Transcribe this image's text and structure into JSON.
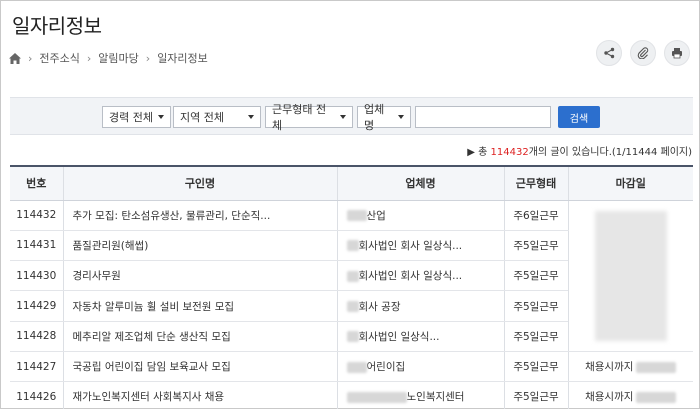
{
  "page": {
    "title": "일자리정보"
  },
  "breadcrumb": {
    "items": [
      "전주소식",
      "알림마당",
      "일자리정보"
    ]
  },
  "filters": {
    "career": "경력 전체",
    "region": "지역 전체",
    "work_type": "근무형태 전체",
    "company": "업체명",
    "search_label": "검색"
  },
  "summary": {
    "prefix": "▶ 총",
    "count": "114432",
    "suffix": "개의 글이 있습니다.(1/11444 페이지)"
  },
  "table": {
    "headers": [
      "번호",
      "구인명",
      "업체명",
      "근무형태",
      "마감일"
    ],
    "rows": [
      {
        "no": "114432",
        "title": "추가 모집: 탄소섬유생산, 물류관리, 단순직...",
        "company": "산업",
        "type": "주6일근무",
        "deadline": ""
      },
      {
        "no": "114431",
        "title": "품질관리원(해썹)",
        "company": "회사법인 회사 일상식...",
        "type": "주5일근무",
        "deadline": ""
      },
      {
        "no": "114430",
        "title": "경리사무원",
        "company": "회사법인 회사 일상식...",
        "type": "주5일근무",
        "deadline": ""
      },
      {
        "no": "114429",
        "title": "자동차 알루미늄 휠 설비 보전원 모집",
        "company": "회사 공장",
        "type": "주5일근무",
        "deadline": ""
      },
      {
        "no": "114428",
        "title": "메추리알 제조업체 단순 생산직 모집",
        "company": "회사법인 일상식...",
        "type": "주5일근무",
        "deadline": ""
      },
      {
        "no": "114427",
        "title": "국공립 어린이집 담임 보육교사 모집",
        "company": "어린이집",
        "type": "주5일근무",
        "deadline": "채용시까지"
      },
      {
        "no": "114426",
        "title": "재가노인복지센터 사회복지사 채용",
        "company": "노인복지센터",
        "type": "주5일근무",
        "deadline": "채용시까지"
      }
    ]
  },
  "icons": {
    "home": "home-icon",
    "share": "share-icon",
    "attach": "paperclip-icon",
    "print": "print-icon"
  },
  "colors": {
    "accent": "#2c6fce",
    "count": "#dd2222"
  }
}
